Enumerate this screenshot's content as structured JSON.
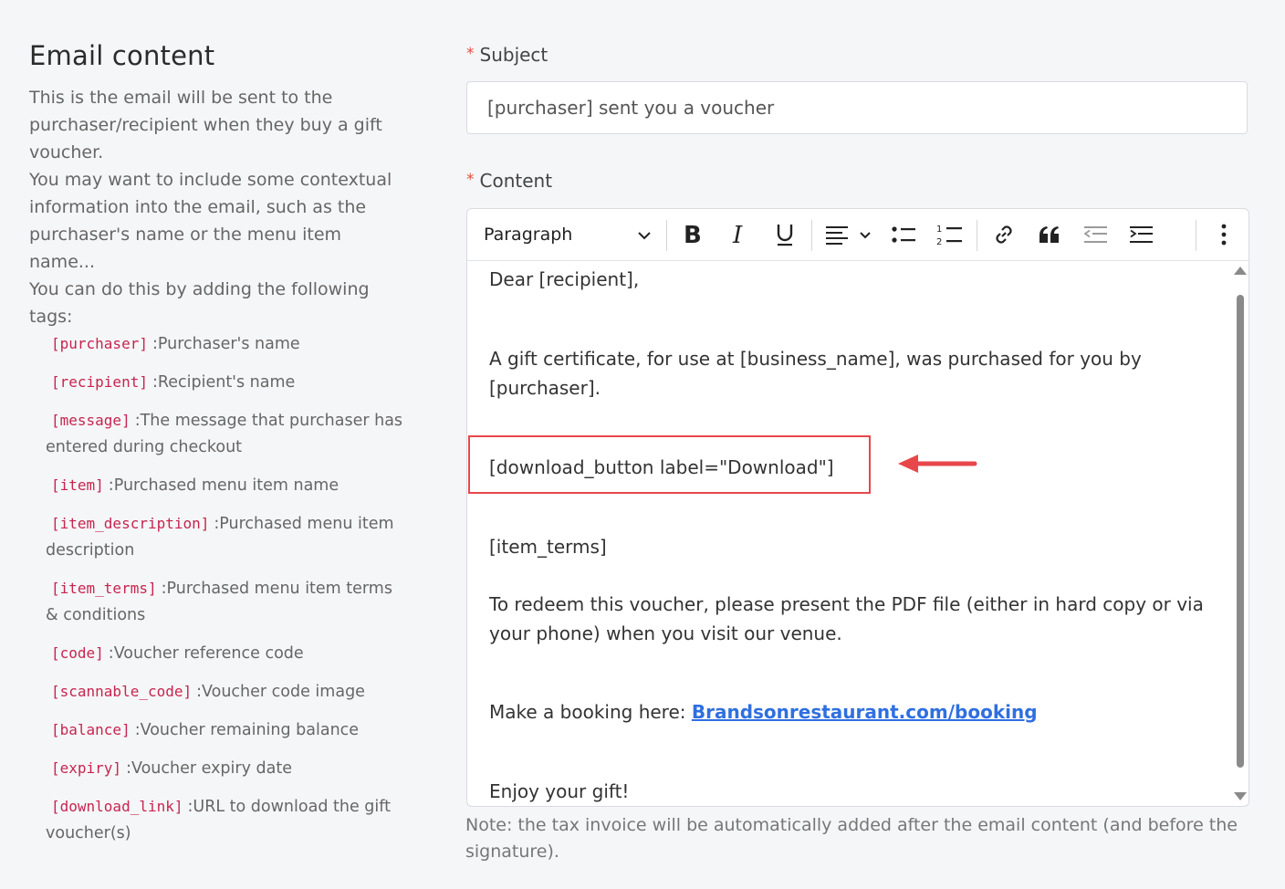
{
  "left": {
    "title": "Email content",
    "description": [
      "This is the email will be sent to the purchaser/recipient when they buy a gift voucher.",
      "You may want to include some contextual information into the email, such as the purchaser's name or the menu item name...",
      "You can do this by adding the following tags:"
    ],
    "tags": [
      {
        "tag": "[purchaser]",
        "desc": ":Purchaser's name"
      },
      {
        "tag": "[recipient]",
        "desc": ":Recipient's name"
      },
      {
        "tag": "[message]",
        "desc": ":The message that purchaser has entered during checkout"
      },
      {
        "tag": "[item]",
        "desc": ":Purchased menu item name"
      },
      {
        "tag": "[item_description]",
        "desc": ":Purchased menu item description"
      },
      {
        "tag": "[item_terms]",
        "desc": ":Purchased menu item terms & conditions"
      },
      {
        "tag": "[code]",
        "desc": ":Voucher reference code"
      },
      {
        "tag": "[scannable_code]",
        "desc": ":Voucher code image"
      },
      {
        "tag": "[balance]",
        "desc": ":Voucher remaining balance"
      },
      {
        "tag": "[expiry]",
        "desc": ":Voucher expiry date"
      },
      {
        "tag": "[download_link]",
        "desc": ":URL to download the gift voucher(s)"
      }
    ]
  },
  "form": {
    "required_mark": "*",
    "subject_label": "Subject",
    "subject_value": "[purchaser] sent you a voucher",
    "content_label": "Content",
    "note": "Note: the tax invoice will be automatically added after the email content (and before the signature)."
  },
  "toolbar": {
    "paragraph_label": "Paragraph",
    "icons": [
      "bold-icon",
      "italic-icon",
      "underline-icon",
      "align-icon",
      "bulleted-list-icon",
      "numbered-list-icon",
      "link-icon",
      "quote-icon",
      "outdent-icon",
      "indent-icon",
      "more-options-icon"
    ]
  },
  "editor": {
    "line1": "Dear [recipient],",
    "line2": "A gift certificate, for use at [business_name], was purchased for you by [purchaser].",
    "line3": "[download_button label=\"Download\"]",
    "line4": "[item_terms]",
    "line5": "To redeem this voucher, please present the PDF file (either in hard copy or via your phone) when you visit our venue.",
    "line6_prefix": "Make a booking here: ",
    "line6_link": "Brandsonrestaurant.com/booking",
    "line7": "Enjoy your gift!"
  },
  "colors": {
    "accent_red": "#e8474a",
    "link_blue": "#2f6fe0",
    "tag_red": "#c7254e"
  }
}
